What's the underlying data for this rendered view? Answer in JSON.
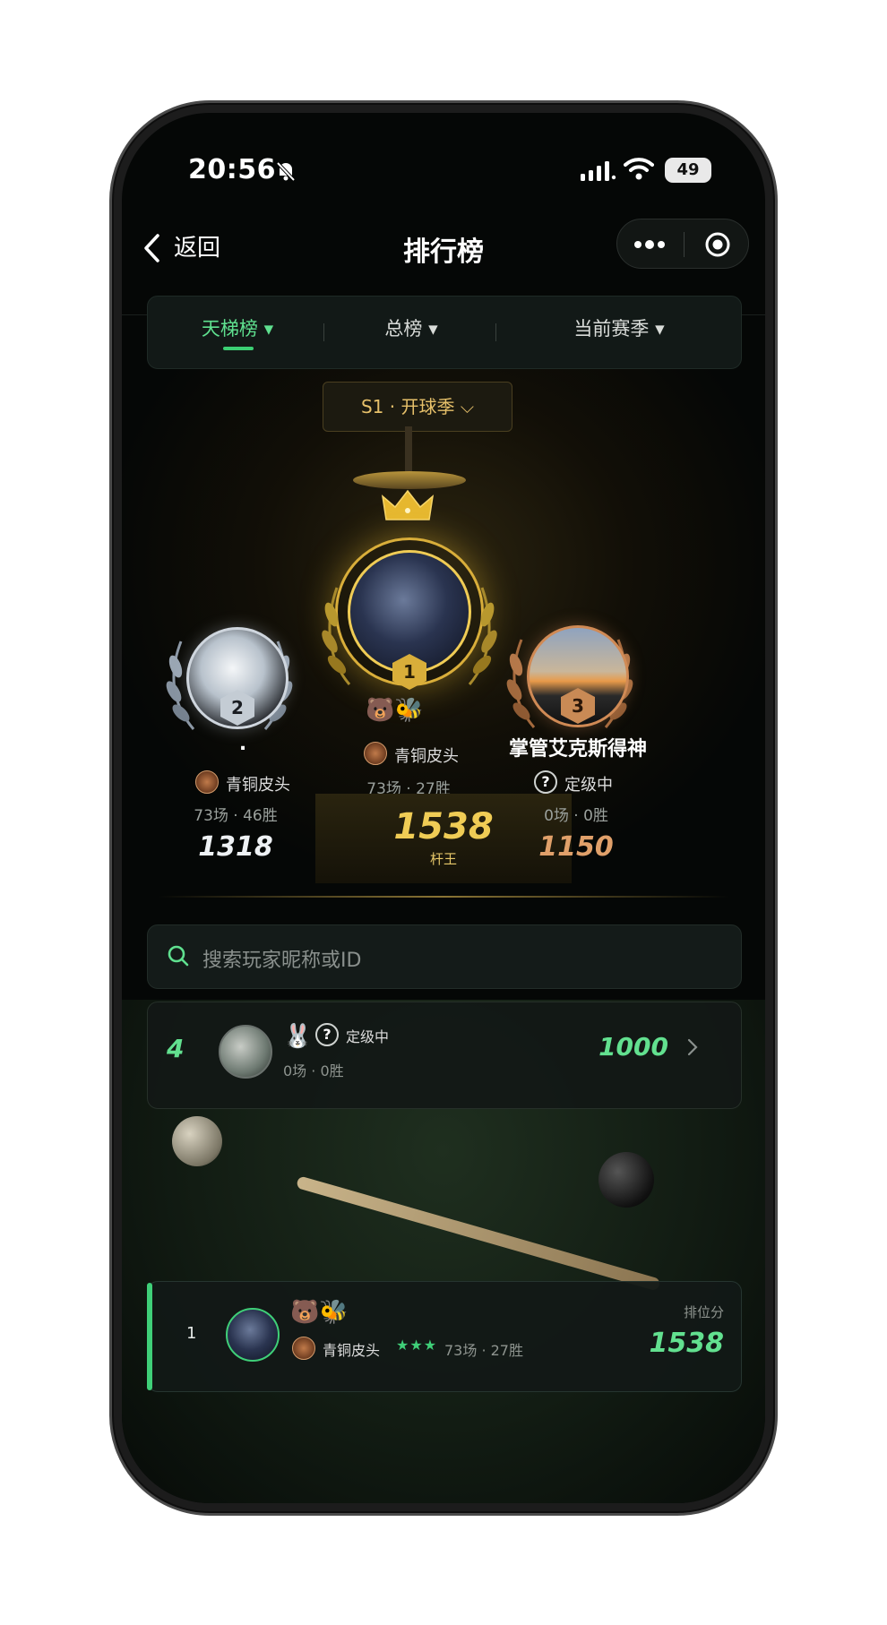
{
  "status": {
    "time": "20:56",
    "battery": "49"
  },
  "nav": {
    "back_label": "返回",
    "title": "排行榜"
  },
  "tabs": [
    {
      "label": "天梯榜 ▾",
      "active": true
    },
    {
      "label": "总榜 ▾",
      "active": false
    },
    {
      "label": "当前赛季 ▾",
      "active": false
    }
  ],
  "season": {
    "label": "S1 · 开球季 ⌵"
  },
  "podium": {
    "first": {
      "rank": "1",
      "emoji": "🐻🐝",
      "tier": "青铜皮头",
      "stats": "73场 · 27胜",
      "score": "1538",
      "title": "杆王"
    },
    "second": {
      "rank": "2",
      "name": ".",
      "tier": "青铜皮头",
      "stats": "73场 · 46胜",
      "score": "1318"
    },
    "third": {
      "rank": "3",
      "name": "掌管艾克斯得神",
      "tier": "定级中",
      "stats": "0场 · 0胜",
      "score": "1150"
    }
  },
  "search": {
    "placeholder": "搜索玩家昵称或ID"
  },
  "list": [
    {
      "rank": "4",
      "emoji": "🐰",
      "tier": "定级中",
      "stats": "0场 · 0胜",
      "score": "1000"
    }
  ],
  "mine": {
    "rank": "1",
    "emoji": "🐻🐝",
    "tier": "青铜皮头",
    "stars": "★★★",
    "stats": "73场 · 27胜",
    "score_label": "排位分",
    "score": "1538"
  },
  "colors": {
    "accent_green": "#3ccf74",
    "gold": "#e6c06a",
    "bronze": "#d0a070",
    "silver": "#cfd6de"
  }
}
